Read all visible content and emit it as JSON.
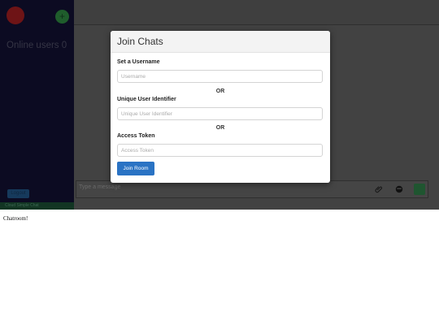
{
  "sidebar": {
    "add_label": "+",
    "online_users": "Online users 0",
    "logout_label": "Logout",
    "footer_link": "Cloud Simple Chat"
  },
  "composer": {
    "placeholder": "Type a message"
  },
  "modal": {
    "title": "Join Chats",
    "username_label": "Set a Username",
    "username_placeholder": "Username",
    "or_1": "OR",
    "uid_label": "Unique User Identifier",
    "uid_placeholder": "Unique User Identifier",
    "or_2": "OR",
    "token_label": "Access Token",
    "token_placeholder": "Access Token",
    "join_label": "Join Room"
  },
  "below_text": "Chatroom!",
  "colors": {
    "primary": "#2a73c4",
    "sidebar_bg": "#0c0b22",
    "overlay": "#4a4a4a"
  }
}
